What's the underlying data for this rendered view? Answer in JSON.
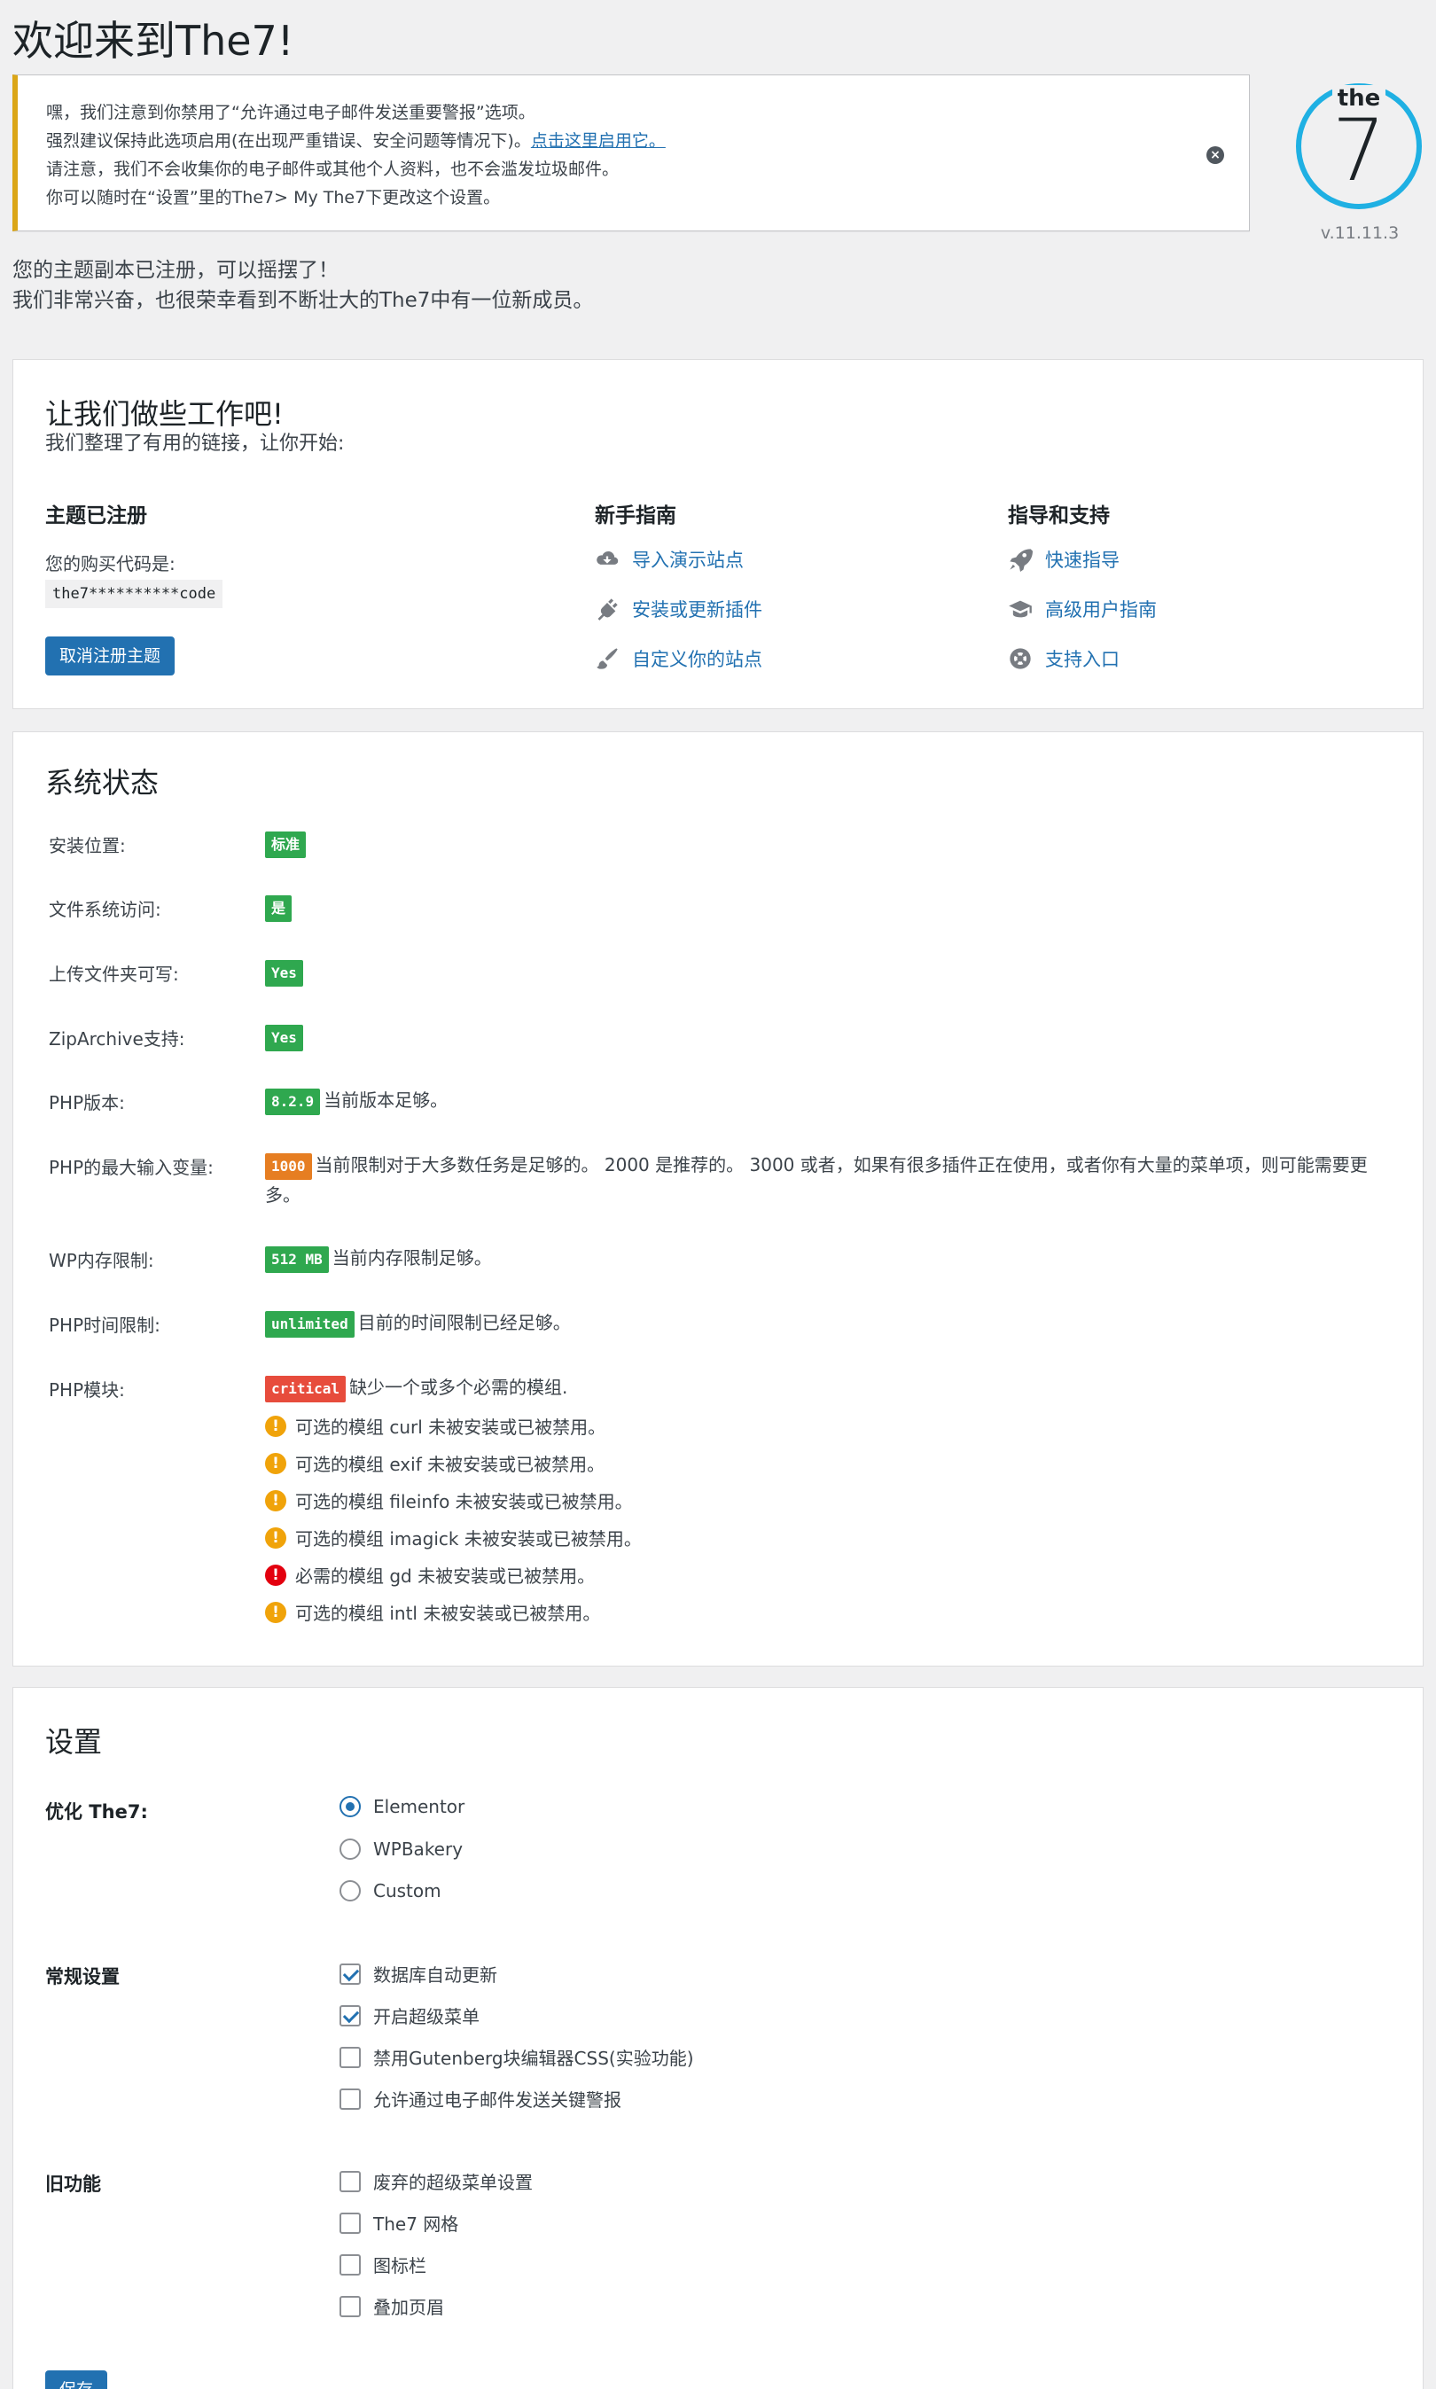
{
  "page_title": "欢迎来到The7!",
  "notice": {
    "line1": "嘿，我们注意到你禁用了“允许通过电子邮件发送重要警报”选项。",
    "line2_text": "强烈建议保持此选项启用(在出现严重错误、安全问题等情况下)。",
    "line2_link": "点击这里启用它。",
    "line3": "请注意，我们不会收集你的电子邮件或其他个人资料，也不会滥发垃圾邮件。",
    "line4": "你可以随时在“设置”里的The7> My The7下更改这个设置。"
  },
  "logo": {
    "top_text": "the",
    "number": "7",
    "version": "v.11.11.3"
  },
  "intro": {
    "line1": "您的主题副本已注册，可以摇摆了！",
    "line2": "我们非常兴奋，也很荣幸看到不断壮大的The7中有一位新成员。"
  },
  "welcome": {
    "title": "让我们做些工作吧!",
    "subtitle": "我们整理了有用的链接，让你开始:",
    "registered": {
      "title": "主题已注册",
      "code_label": "您的购买代码是:",
      "code": "the7**********code",
      "button": "取消注册主题"
    },
    "getting_started": {
      "title": "新手指南",
      "links": [
        "导入演示站点",
        "安装或更新插件",
        "自定义你的站点"
      ]
    },
    "support": {
      "title": "指导和支持",
      "links": [
        "快速指导",
        "高级用户指南",
        "支持入口"
      ]
    }
  },
  "system_status": {
    "title": "系统状态",
    "rows": [
      {
        "label": "安装位置:",
        "badge": "标准",
        "text": ""
      },
      {
        "label": "文件系统访问:",
        "badge": "是",
        "text": ""
      },
      {
        "label": "上传文件夹可写:",
        "badge": "Yes",
        "text": ""
      },
      {
        "label": "ZipArchive支持:",
        "badge": "Yes",
        "text": ""
      },
      {
        "label": "PHP版本:",
        "badge": "8.2.9",
        "text": "当前版本足够。"
      },
      {
        "label": "PHP的最大输入变量:",
        "badge": "1000",
        "text": "当前限制对于大多数任务是足够的。 2000 是推荐的。 3000 或者，如果有很多插件正在使用，或者你有大量的菜单项，则可能需要更多。"
      },
      {
        "label": "WP内存限制:",
        "badge": "512 MB",
        "text": "当前内存限制足够。"
      },
      {
        "label": "PHP时间限制:",
        "badge": "unlimited",
        "text": "目前的时间限制已经足够。"
      },
      {
        "label": "PHP模块:",
        "badge": "critical",
        "text": "缺少一个或多个必需的模组."
      }
    ],
    "modules": [
      {
        "text": "可选的模组 curl 未被安装或已被禁用。",
        "level": "warning"
      },
      {
        "text": "可选的模组 exif 未被安装或已被禁用。",
        "level": "warning"
      },
      {
        "text": "可选的模组 fileinfo 未被安装或已被禁用。",
        "level": "warning"
      },
      {
        "text": "可选的模组 imagick 未被安装或已被禁用。",
        "level": "warning"
      },
      {
        "text": "必需的模组 gd 未被安装或已被禁用。",
        "level": "error"
      },
      {
        "text": "可选的模组 intl 未被安装或已被禁用。",
        "level": "warning"
      }
    ]
  },
  "settings": {
    "title": "设置",
    "optimize": {
      "label": "优化 The7:",
      "options": [
        "Elementor",
        "WPBakery",
        "Custom"
      ],
      "selected": "Elementor"
    },
    "general": {
      "label": "常规设置",
      "options": [
        {
          "label": "数据库自动更新",
          "checked": true
        },
        {
          "label": "开启超级菜单",
          "checked": true
        },
        {
          "label": "禁用Gutenberg块编辑器CSS(实验功能)",
          "checked": false
        },
        {
          "label": "允许通过电子邮件发送关键警报",
          "checked": false
        }
      ]
    },
    "legacy": {
      "label": "旧功能",
      "options": [
        {
          "label": "废弃的超级菜单设置",
          "checked": false
        },
        {
          "label": "The7 网格",
          "checked": false
        },
        {
          "label": "图标栏",
          "checked": false
        },
        {
          "label": "叠加页眉",
          "checked": false
        }
      ]
    },
    "save_button": "保存"
  },
  "colors": {
    "accent": "#2271b1",
    "badge_green": "#2fa84f",
    "badge_orange": "#e67e22",
    "badge_red": "#e74c3c",
    "logo_ring": "#1fb0e3",
    "notice_border": "#dba617"
  }
}
